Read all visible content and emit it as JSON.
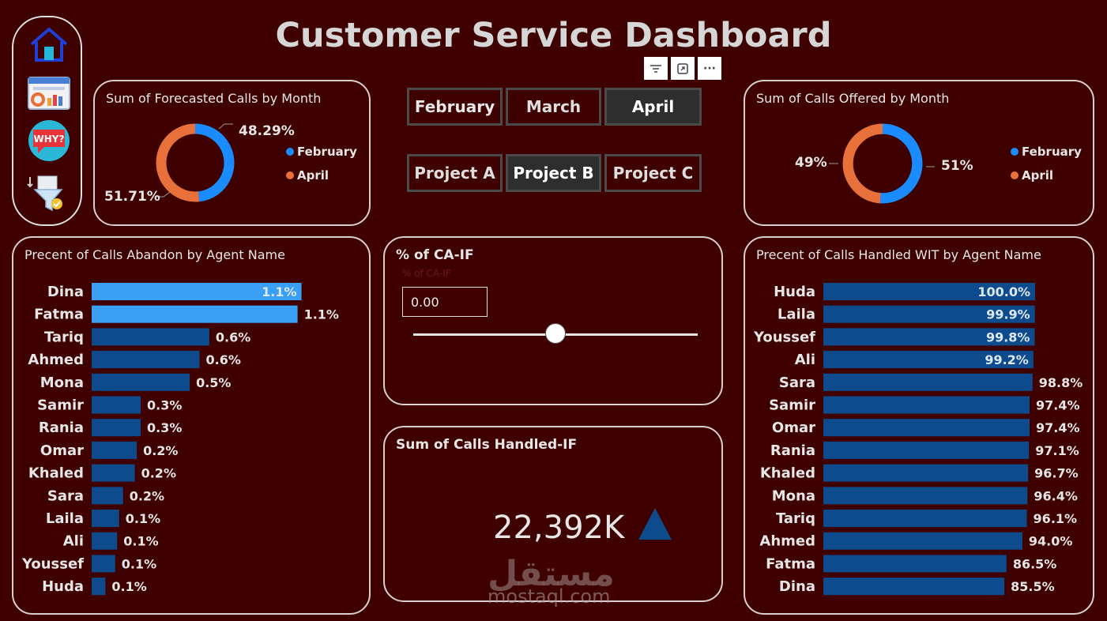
{
  "header": {
    "title": "Customer Service Dashboard"
  },
  "nav": [
    {
      "icon": "home-icon"
    },
    {
      "icon": "dashboard-icon"
    },
    {
      "icon": "why-icon",
      "label": "WHY?"
    },
    {
      "icon": "funnel-icon"
    }
  ],
  "visual_toolbar": [
    {
      "icon": "filter-icon"
    },
    {
      "icon": "focus-mode-icon"
    },
    {
      "icon": "more-options-icon",
      "label": "···"
    }
  ],
  "month_slicer": [
    {
      "label": "February",
      "state": "selected"
    },
    {
      "label": "March",
      "state": "none"
    },
    {
      "label": "April",
      "state": "dark"
    }
  ],
  "project_slicer": [
    {
      "label": "Project A",
      "state": "none"
    },
    {
      "label": "Project B",
      "state": "dark"
    },
    {
      "label": "Project C",
      "state": "none"
    }
  ],
  "forecast_panel": {
    "title": "Sum of Forecasted Calls by Month"
  },
  "offered_panel": {
    "title": "Sum of Calls Offered by Month"
  },
  "abandon_panel": {
    "title": "Precent of Calls Abandon by Agent Name"
  },
  "ca_panel": {
    "title": "% of CA-IF",
    "subtitle": "% of CA-IF",
    "value": "0.00",
    "slider_level": 0.5
  },
  "handled_panel": {
    "title": "Sum of Calls Handled-IF",
    "value": "22,392K",
    "trend_icon": "up-triangle-icon",
    "trend_color": "#0d4b8c"
  },
  "handled_wit_panel": {
    "title": "Precent of Calls Handled WIT by Agent Name"
  },
  "watermark": {
    "arabic": "مستقل",
    "latin": "mostaql.com"
  },
  "colors": {
    "background": "#3f0000",
    "february": "#1a8cff",
    "april": "#e8703a",
    "bar_highlight": "#3aa0f5",
    "bar_dark": "#0d4b8c"
  },
  "chart_data": [
    {
      "type": "pie",
      "title": "Sum of Forecasted Calls by Month",
      "categories": [
        "February",
        "April"
      ],
      "values": [
        48.29,
        51.71
      ],
      "labels": [
        "48.29%",
        "51.71%"
      ],
      "legend": "right",
      "colors": [
        "#1a8cff",
        "#e8703a"
      ]
    },
    {
      "type": "pie",
      "title": "Sum of Calls Offered by Month",
      "categories": [
        "February",
        "April"
      ],
      "values": [
        51,
        49
      ],
      "labels": [
        "51%",
        "49%"
      ],
      "legend": "right",
      "colors": [
        "#1a8cff",
        "#e8703a"
      ]
    },
    {
      "type": "bar",
      "orientation": "horizontal",
      "title": "Precent of Calls Abandon by Agent Name",
      "categories": [
        "Dina",
        "Fatma",
        "Tariq",
        "Ahmed",
        "Mona",
        "Samir",
        "Rania",
        "Omar",
        "Khaled",
        "Sara",
        "Laila",
        "Ali",
        "Youssef",
        "Huda"
      ],
      "values": [
        1.07,
        1.05,
        0.6,
        0.55,
        0.5,
        0.25,
        0.25,
        0.23,
        0.22,
        0.16,
        0.14,
        0.13,
        0.12,
        0.07
      ],
      "labels": [
        "1.1%",
        "1.1%",
        "0.6%",
        "0.6%",
        "0.5%",
        "0.3%",
        "0.3%",
        "0.2%",
        "0.2%",
        "0.2%",
        "0.1%",
        "0.1%",
        "0.1%",
        "0.1%"
      ],
      "highlight_count": 2,
      "xlim": [
        0,
        1.1
      ]
    },
    {
      "type": "bar",
      "orientation": "horizontal",
      "title": "Precent of Calls Handled WIT by Agent Name",
      "categories": [
        "Huda",
        "Laila",
        "Youssef",
        "Ali",
        "Sara",
        "Samir",
        "Omar",
        "Rania",
        "Khaled",
        "Mona",
        "Tariq",
        "Ahmed",
        "Fatma",
        "Dina"
      ],
      "values": [
        100.0,
        99.9,
        99.8,
        99.2,
        98.8,
        97.4,
        97.4,
        97.1,
        96.7,
        96.4,
        96.1,
        94.0,
        86.5,
        85.5
      ],
      "labels": [
        "100.0%",
        "99.9%",
        "99.8%",
        "99.2%",
        "98.8%",
        "97.4%",
        "97.4%",
        "97.1%",
        "96.7%",
        "96.4%",
        "96.1%",
        "94.0%",
        "86.5%",
        "85.5%"
      ],
      "inside_label_count": 4,
      "xlim": [
        0,
        100
      ]
    }
  ]
}
